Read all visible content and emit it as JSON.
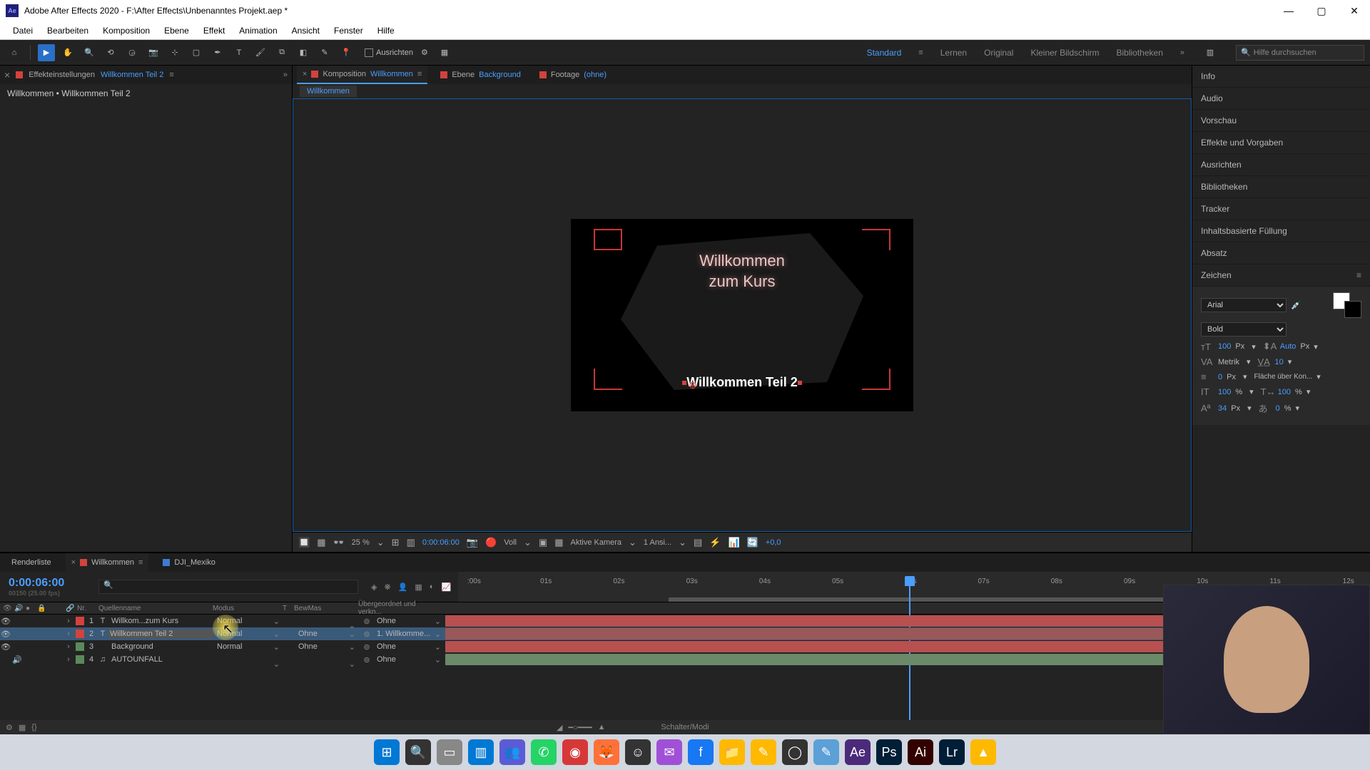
{
  "titlebar": {
    "app": "Adobe After Effects 2020",
    "path": "F:\\After Effects\\Unbenanntes Projekt.aep *"
  },
  "menu": [
    "Datei",
    "Bearbeiten",
    "Komposition",
    "Ebene",
    "Effekt",
    "Animation",
    "Ansicht",
    "Fenster",
    "Hilfe"
  ],
  "workspaces": {
    "active": "Standard",
    "items": [
      "Standard",
      "Lernen",
      "Original",
      "Kleiner Bildschirm",
      "Bibliotheken"
    ]
  },
  "toolbar": {
    "ausrichten": "Ausrichten",
    "search_help_placeholder": "Hilfe durchsuchen"
  },
  "effect_panel": {
    "tab_label": "Effekteinstellungen",
    "tab_value": "Willkommen Teil 2",
    "breadcrumb": "Willkommen • Willkommen Teil 2"
  },
  "composition_panel": {
    "tabs": [
      {
        "label": "Komposition",
        "value": "Willkommen",
        "active": true
      },
      {
        "label": "Ebene",
        "value": "Background",
        "active": false
      },
      {
        "label": "Footage",
        "value": "(ohne)",
        "active": false
      }
    ],
    "crumb": "Willkommen",
    "canvas": {
      "line1": "Willkommen",
      "line2": "zum Kurs",
      "subtitle": "Willkommen Teil 2"
    }
  },
  "viewer_controls": {
    "zoom": "25 %",
    "timecode": "0:00:06:00",
    "resolution": "Voll",
    "camera": "Aktive Kamera",
    "views": "1 Ansi...",
    "exposure": "+0,0"
  },
  "right_panels": [
    "Info",
    "Audio",
    "Vorschau",
    "Effekte und Vorgaben",
    "Ausrichten",
    "Bibliotheken",
    "Tracker",
    "Inhaltsbasierte Füllung",
    "Absatz"
  ],
  "char_panel": {
    "title": "Zeichen",
    "font": "Arial",
    "weight": "Bold",
    "size": "100",
    "size_unit": "Px",
    "auto_leading": "Auto",
    "auto_unit": "Px",
    "kerning": "Metrik",
    "tracking": "10",
    "stroke": "0",
    "stroke_unit": "Px",
    "fill_over": "Fläche über Kon...",
    "vscale": "100",
    "hscale": "100",
    "baseline": "34",
    "baseline_unit": "Px",
    "tsume": "0",
    "pct": "%"
  },
  "timeline": {
    "tabs": [
      {
        "label": "Renderliste",
        "color": "none"
      },
      {
        "label": "Willkommen",
        "color": "red",
        "active": true
      },
      {
        "label": "DJI_Mexiko",
        "color": "blue"
      }
    ],
    "timecode": "0:00:06:00",
    "timecode_sub": "00150 (25.00 fps)",
    "columns": {
      "nr": "Nr.",
      "quellenname": "Quellenname",
      "modus": "Modus",
      "t": "T",
      "bewmas": "BewMas",
      "parent": "Übergeordnet und verkn..."
    },
    "ticks": [
      ":00s",
      "01s",
      "02s",
      "03s",
      "04s",
      "05s",
      "06s",
      "07s",
      "08s",
      "09s",
      "10s",
      "11s",
      "12s"
    ],
    "layers": [
      {
        "idx": "1",
        "color": "#d3423d",
        "type": "T",
        "name": "Willkom...zum Kurs",
        "mode": "Normal",
        "bewmas": "",
        "parent": "Ohne",
        "bar_color": "#b85050",
        "bar_left": 0,
        "bar_right": 0,
        "eye": true
      },
      {
        "idx": "2",
        "color": "#d3423d",
        "type": "T",
        "name": "Willkommen Teil 2",
        "mode": "Normal",
        "bewmas": "Ohne",
        "parent": "1. Willkomme...",
        "bar_color": "#9a5858",
        "bar_left": 0,
        "bar_right": 0,
        "eye": true,
        "selected": true
      },
      {
        "idx": "3",
        "color": "#5a8a5a",
        "type": "",
        "name": "Background",
        "mode": "Normal",
        "bewmas": "Ohne",
        "parent": "Ohne",
        "bar_color": "#b85050",
        "bar_left": 0,
        "bar_right": 0,
        "eye": true
      },
      {
        "idx": "4",
        "color": "#5a8a5a",
        "type": "♫",
        "name": "AUTOUNFALL",
        "mode": "",
        "bewmas": "",
        "parent": "Ohne",
        "bar_color": "#6a8a6a",
        "bar_left": 0,
        "bar_right": 0,
        "speaker": true
      }
    ],
    "footer_label": "Schalter/Modi"
  },
  "taskbar_icons": [
    {
      "bg": "#0078d4",
      "glyph": "⊞"
    },
    {
      "bg": "#333",
      "glyph": "🔍"
    },
    {
      "bg": "#888",
      "glyph": "▭"
    },
    {
      "bg": "#0078d4",
      "glyph": "▥"
    },
    {
      "bg": "#5b5bd6",
      "glyph": "👥"
    },
    {
      "bg": "#25d366",
      "glyph": "✆"
    },
    {
      "bg": "#d63838",
      "glyph": "◉"
    },
    {
      "bg": "#ff7139",
      "glyph": "🦊"
    },
    {
      "bg": "#333",
      "glyph": "☺"
    },
    {
      "bg": "#a050d6",
      "glyph": "✉"
    },
    {
      "bg": "#1877f2",
      "glyph": "f"
    },
    {
      "bg": "#ffb900",
      "glyph": "📁"
    },
    {
      "bg": "#ffb900",
      "glyph": "✎"
    },
    {
      "bg": "#333",
      "glyph": "◯"
    },
    {
      "bg": "#5ba0d6",
      "glyph": "✎"
    },
    {
      "bg": "#4b2a7a",
      "glyph": "Ae"
    },
    {
      "bg": "#001e36",
      "glyph": "Ps"
    },
    {
      "bg": "#330000",
      "glyph": "Ai"
    },
    {
      "bg": "#001e36",
      "glyph": "Lr"
    },
    {
      "bg": "#ffb900",
      "glyph": "▲"
    }
  ]
}
